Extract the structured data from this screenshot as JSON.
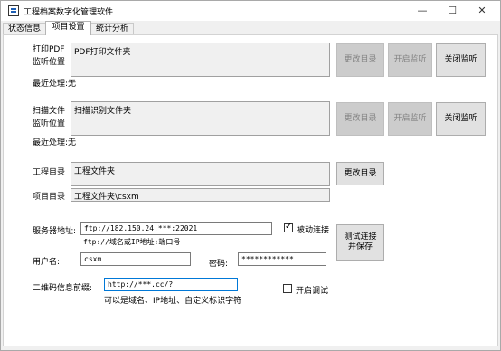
{
  "window": {
    "title": "工程档案数字化管理软件"
  },
  "tabs": [
    {
      "label": "状态信息"
    },
    {
      "label": "项目设置"
    },
    {
      "label": "统计分析"
    }
  ],
  "print_section": {
    "label_line1": "打印PDF",
    "label_line2": "监听位置",
    "folder": "PDF打印文件夹",
    "change_btn": "更改目录",
    "start_btn": "开启监听",
    "stop_btn": "关闭监听",
    "recent_label": "最近处理:无"
  },
  "scan_section": {
    "label_line1": "扫描文件",
    "label_line2": "监听位置",
    "folder": "扫描识别文件夹",
    "change_btn": "更改目录",
    "start_btn": "开启监听",
    "stop_btn": "关闭监听",
    "recent_label": "最近处理:无"
  },
  "project_section": {
    "project_dir_label": "工程目录",
    "project_dir_value": "工程文件夹",
    "change_btn": "更改目录",
    "item_dir_label": "项目目录",
    "item_dir_value": "工程文件夹\\csxm"
  },
  "server_section": {
    "server_label": "服务器地址:",
    "server_value": "ftp://182.150.24.***:22021",
    "server_hint": "ftp://域名或IP地址:端口号",
    "passive_label": "被动连接",
    "passive_checked": true,
    "user_label": "用户名:",
    "user_value": "csxm",
    "pwd_label": "密码:",
    "pwd_value": "************",
    "test_btn_line1": "测试连接",
    "test_btn_line2": "并保存"
  },
  "qr_section": {
    "label": "二维码信息前缀:",
    "value": "http://***.cc/?",
    "hint": "可以是域名、IP地址、自定义标识字符",
    "debug_label": "开启调试",
    "debug_checked": false
  },
  "colors": {
    "accent": "#0078d7",
    "panel_bg": "#f0f0f0",
    "disabled_btn": "#cccccc"
  }
}
